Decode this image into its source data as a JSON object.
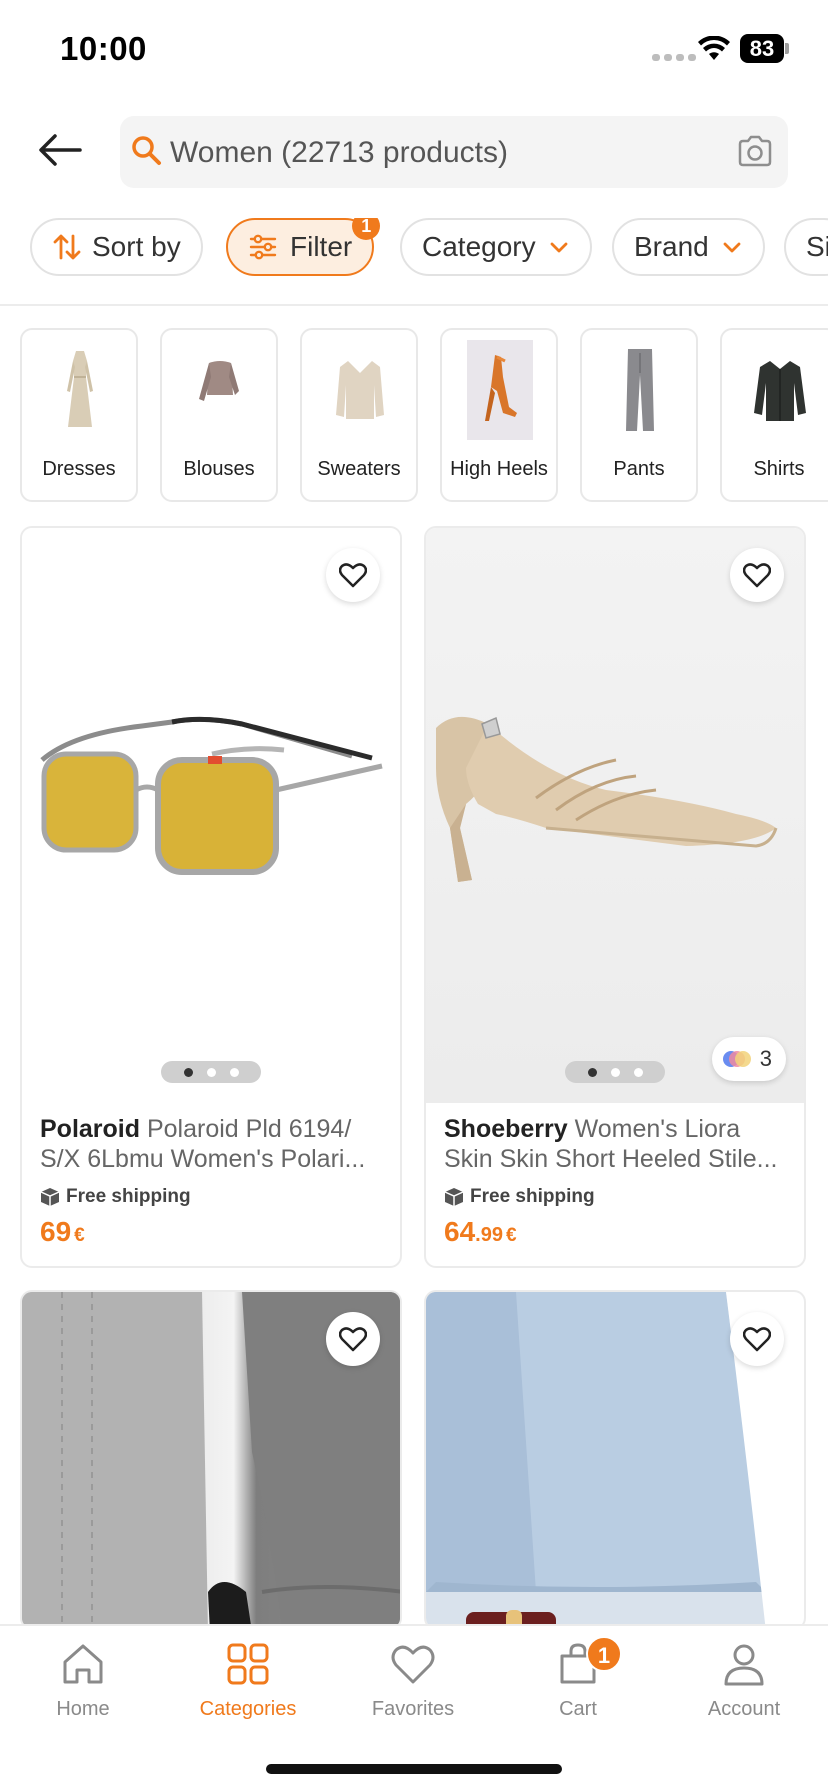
{
  "status": {
    "time": "10:00",
    "battery": "83"
  },
  "search": {
    "text": "Women (22713 products)"
  },
  "chips": [
    {
      "label": "Sort by"
    },
    {
      "label": "Filter",
      "badge": "1"
    },
    {
      "label": "Category"
    },
    {
      "label": "Brand"
    },
    {
      "label": "Si"
    }
  ],
  "categories": [
    {
      "label": "Dresses",
      "icon": "dress-image"
    },
    {
      "label": "Blouses",
      "icon": "blouse-image"
    },
    {
      "label": "Sweaters",
      "icon": "sweater-image"
    },
    {
      "label": "High Heels",
      "icon": "high-heels-image"
    },
    {
      "label": "Pants",
      "icon": "pants-image"
    },
    {
      "label": "Shirts",
      "icon": "shirt-image"
    }
  ],
  "products": [
    {
      "brand": "Polaroid",
      "name": "Polaroid Pld 6194/ S/X 6Lbmu Women's Polari...",
      "shipping": "Free shipping",
      "price_int": "69",
      "price_dec": "",
      "currency": "€"
    },
    {
      "brand": "Shoeberry",
      "name": "Women's Liora Skin Skin Short Heeled Stile...",
      "shipping": "Free shipping",
      "price_int": "64",
      "price_dec": ".99",
      "currency": "€",
      "colors_count": "3"
    }
  ],
  "nav": {
    "home": "Home",
    "categories": "Categories",
    "favorites": "Favorites",
    "cart": "Cart",
    "cart_badge": "1",
    "account": "Account"
  },
  "colors": {
    "accent": "#f07a1c",
    "chip_active_bg": "#fdeee0"
  }
}
